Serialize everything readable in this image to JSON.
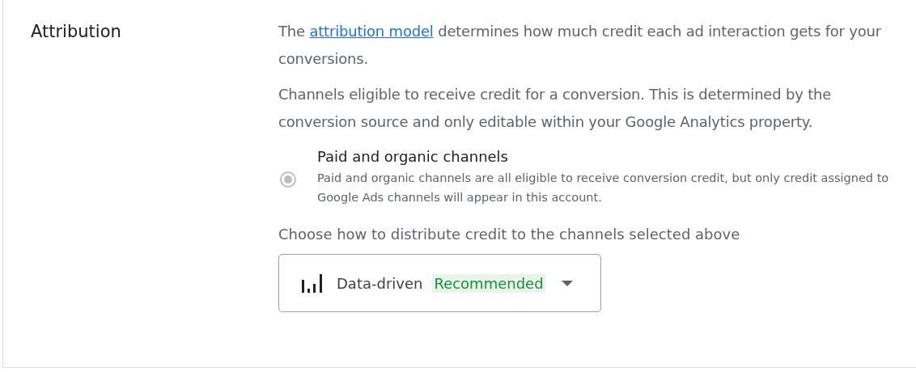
{
  "section": {
    "title": "Attribution"
  },
  "intro": {
    "before": "The ",
    "link": "attribution model",
    "after": " determines how much credit each ad interaction gets for your conversions."
  },
  "eligibility_note": "Channels eligible to receive credit for a conversion. This is determined by the conversion source and only editable within your Google Analytics property.",
  "options": [
    {
      "label": "Paid and organic channels",
      "description": "Paid and organic channels are all eligible to receive conversion credit, but only credit assigned to Google Ads channels will appear in this account.",
      "selected": true,
      "disabled": true
    }
  ],
  "model_prompt": "Choose how to distribute credit to the channels selected above",
  "model_select": {
    "value": "Data-driven",
    "badge": "Recommended"
  }
}
